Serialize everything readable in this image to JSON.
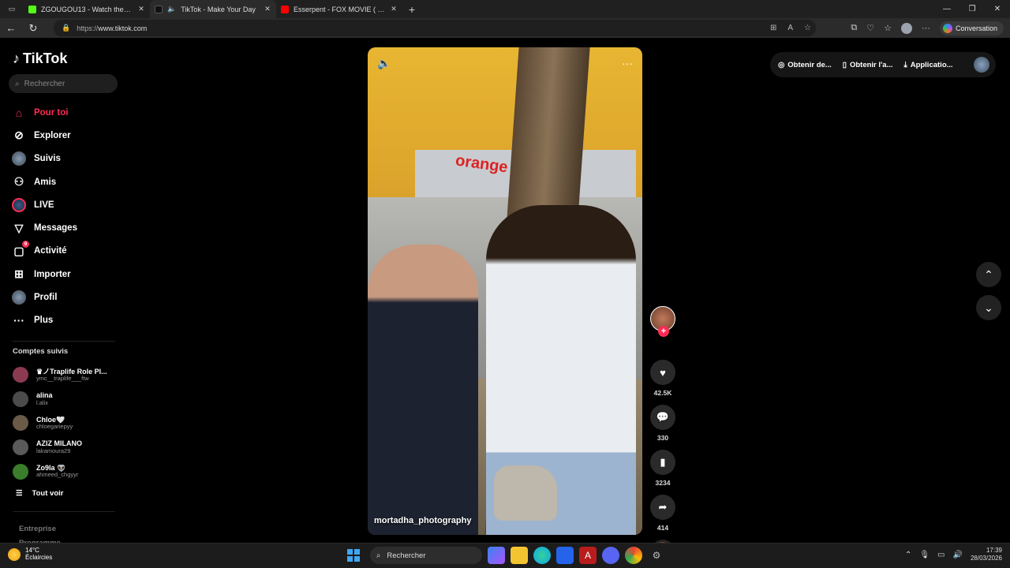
{
  "browser": {
    "tabs": [
      {
        "title": "ZGOUGOU13 - Watch the VOD on",
        "favicon_color": "#53fc18"
      },
      {
        "title": "TikTok - Make Your Day",
        "favicon_color": "#111111"
      },
      {
        "title": "Esserpent - FOX MOVIE ( officiel )",
        "favicon_color": "#ff0000"
      }
    ],
    "url_scheme": "https://",
    "url_host": "www.tiktok.com",
    "conversation_label": "Conversation"
  },
  "sidebar": {
    "logo": "TikTok",
    "search_placeholder": "Rechercher",
    "nav": [
      {
        "label": "Pour toi",
        "icon": "home-icon"
      },
      {
        "label": "Explorer",
        "icon": "compass-icon"
      },
      {
        "label": "Suivis",
        "icon": "following-avatar-icon"
      },
      {
        "label": "Amis",
        "icon": "friends-icon"
      },
      {
        "label": "LIVE",
        "icon": "live-icon"
      },
      {
        "label": "Messages",
        "icon": "send-icon"
      },
      {
        "label": "Activité",
        "icon": "inbox-icon",
        "badge": "9"
      },
      {
        "label": "Importer",
        "icon": "upload-icon"
      },
      {
        "label": "Profil",
        "icon": "profile-icon"
      },
      {
        "label": "Plus",
        "icon": "more-icon"
      }
    ],
    "followed_title": "Comptes suivis",
    "accounts": [
      {
        "name": "♛ノ​Traplife Role Pl...",
        "handle": "ymc__traplife___ftw",
        "color": "#8b3a52"
      },
      {
        "name": "alina",
        "handle": "l.alix",
        "color": "#4b4b4b"
      },
      {
        "name": "Chloe🤍",
        "handle": "chloegariepyy",
        "color": "#6b5a48"
      },
      {
        "name": "AZIZ MILANO",
        "handle": "lakamoura29",
        "color": "#5a5a5a"
      },
      {
        "name": "Zo9la 👽",
        "handle": "ahmeed_chgyyr",
        "color": "#3a7d2a"
      }
    ],
    "see_all": "Tout voir",
    "footer": [
      "Entreprise",
      "Programme"
    ]
  },
  "video": {
    "caption": "mortadha_photography",
    "sign_text": "orange"
  },
  "actions": {
    "likes": "42.5K",
    "comments": "330",
    "saves": "3234",
    "shares": "414"
  },
  "topright": {
    "btn1": "Obtenir de...",
    "btn2": "Obtenir l'a...",
    "btn3": "Applicatio..."
  },
  "taskbar": {
    "temp": "14°C",
    "weather": "Éclaircies",
    "search": "Rechercher",
    "time": "17:39",
    "date": "28/03/2026"
  },
  "colors": {
    "accent": "#fe2c55",
    "background": "#000000"
  }
}
